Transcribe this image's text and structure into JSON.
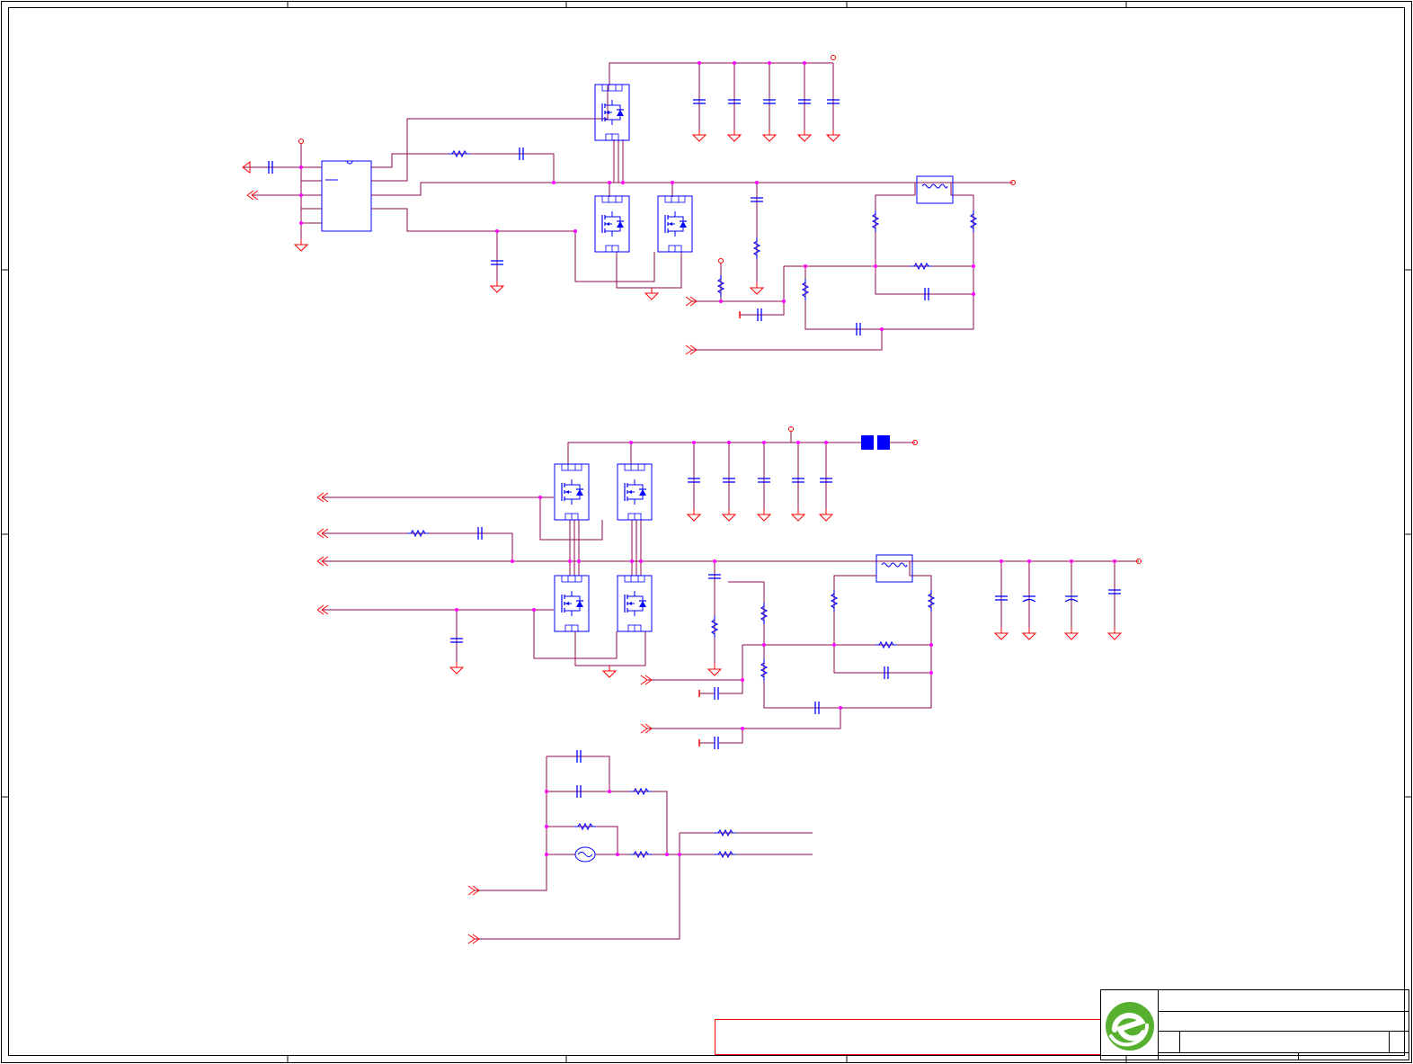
{
  "drawing": {
    "kind": "schematic",
    "text_labels": []
  },
  "title_block": {
    "logo": "green-e-logo",
    "fields": []
  },
  "colors": {
    "wire": "#8b0a50",
    "component": "#0000ff",
    "power_symbol": "#ff0000",
    "junction": "#ff00ff",
    "frame": "#000000",
    "logo": "#58b031"
  }
}
